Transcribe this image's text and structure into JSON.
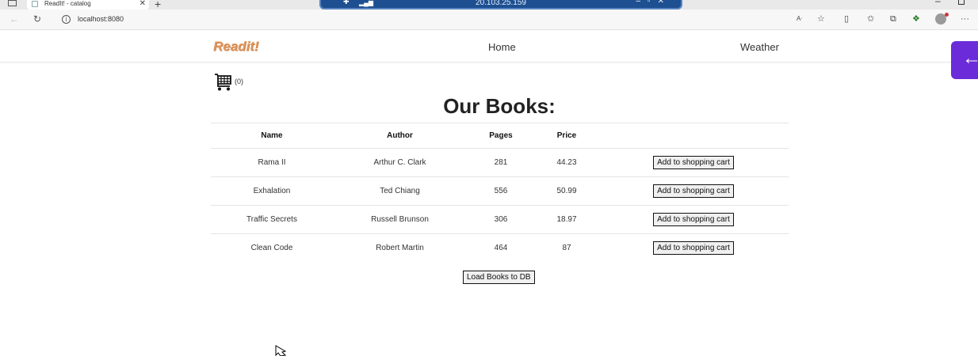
{
  "browser": {
    "tab_title": "ReadIt! - catalog",
    "tab_close": "✕",
    "new_tab": "+",
    "url": "localhost:8080",
    "back": "←",
    "reload": "↻"
  },
  "remote_desktop": {
    "address": "20.103.25.159"
  },
  "navbar": {
    "brand": "Readit!",
    "links": [
      "Home",
      "Weather"
    ]
  },
  "cart": {
    "count": "(0)"
  },
  "page": {
    "heading": "Our Books:"
  },
  "table": {
    "columns": [
      "Name",
      "Author",
      "Pages",
      "Price"
    ],
    "rows": [
      {
        "name": "Rama II",
        "author": "Arthur C. Clark",
        "pages": "281",
        "price": "44.23"
      },
      {
        "name": "Exhalation",
        "author": "Ted Chiang",
        "pages": "556",
        "price": "50.99"
      },
      {
        "name": "Traffic Secrets",
        "author": "Russell Brunson",
        "pages": "306",
        "price": "18.97"
      },
      {
        "name": "Clean Code",
        "author": "Robert Martin",
        "pages": "464",
        "price": "87"
      }
    ],
    "row_button": "Add to shopping cart"
  },
  "actions": {
    "load_button": "Load Books to DB"
  },
  "colors": {
    "brand": "#e0955a",
    "side_tab": "#6c2bd9",
    "rdp_bar": "#1d4f91"
  }
}
